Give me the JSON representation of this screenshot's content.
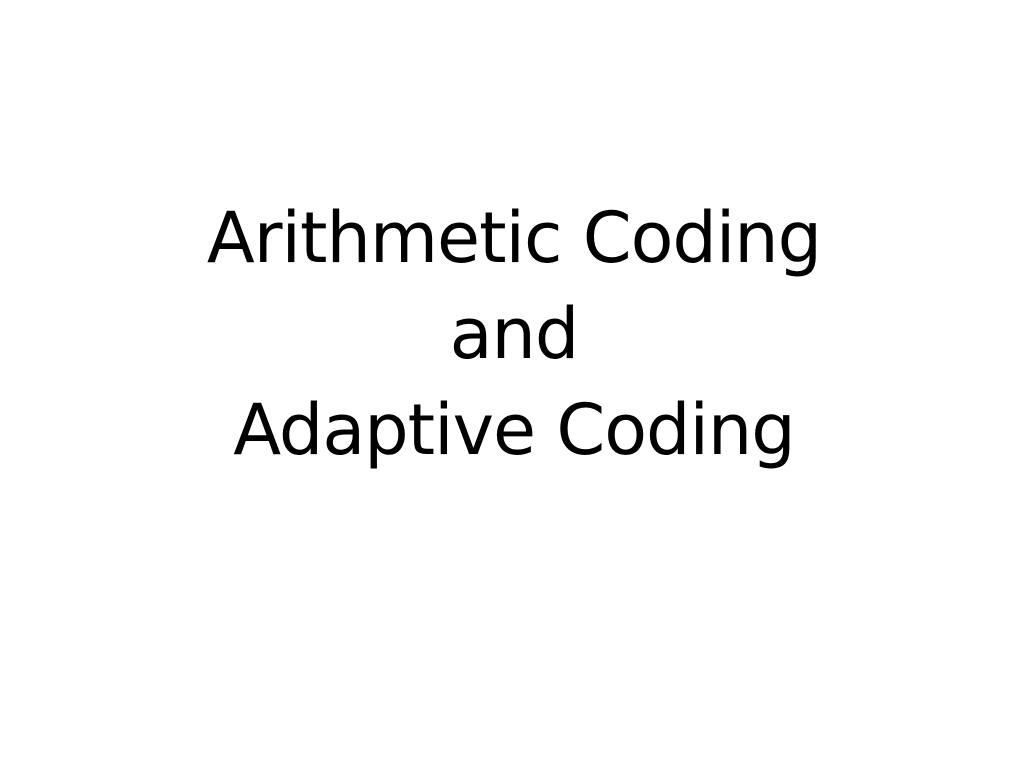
{
  "slide": {
    "title_lines": [
      "Arithmetic Coding",
      "and",
      "Adaptive Coding"
    ],
    "colors": {
      "background": "#ffffff",
      "text": "#000000"
    }
  }
}
